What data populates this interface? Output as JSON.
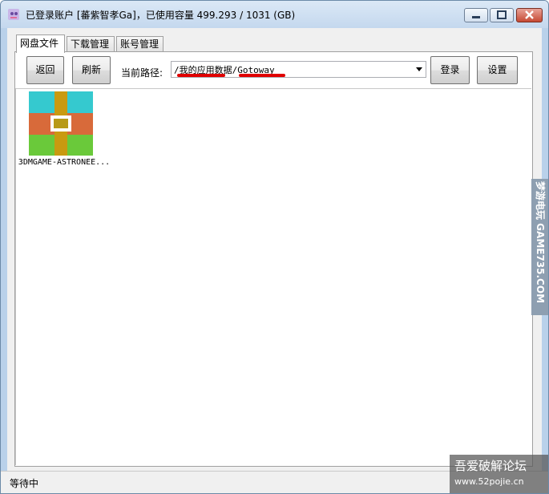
{
  "window": {
    "title": "已登录账户 [蕃紫智孝Ga]，已使用容量 499.293 / 1031 (GB)"
  },
  "tabs": [
    "网盘文件",
    "下载管理",
    "账号管理"
  ],
  "toolbar": {
    "back_label": "返回",
    "refresh_label": "刷新",
    "path_label": "当前路径:",
    "path_value": "/我的应用数据/Gotoway",
    "login_label": "登录",
    "settings_label": "设置"
  },
  "files": [
    {
      "name": "3DMGAME-ASTRONEE...",
      "icon": "archive-icon"
    }
  ],
  "status": {
    "text": "等待中"
  },
  "watermarks": {
    "side": "梦游电玩 GAME735.COM",
    "corner_line1": "吾爱破解论坛",
    "corner_line2": "www.52pojie.cn"
  },
  "colors": {
    "mark": "#e00000"
  }
}
